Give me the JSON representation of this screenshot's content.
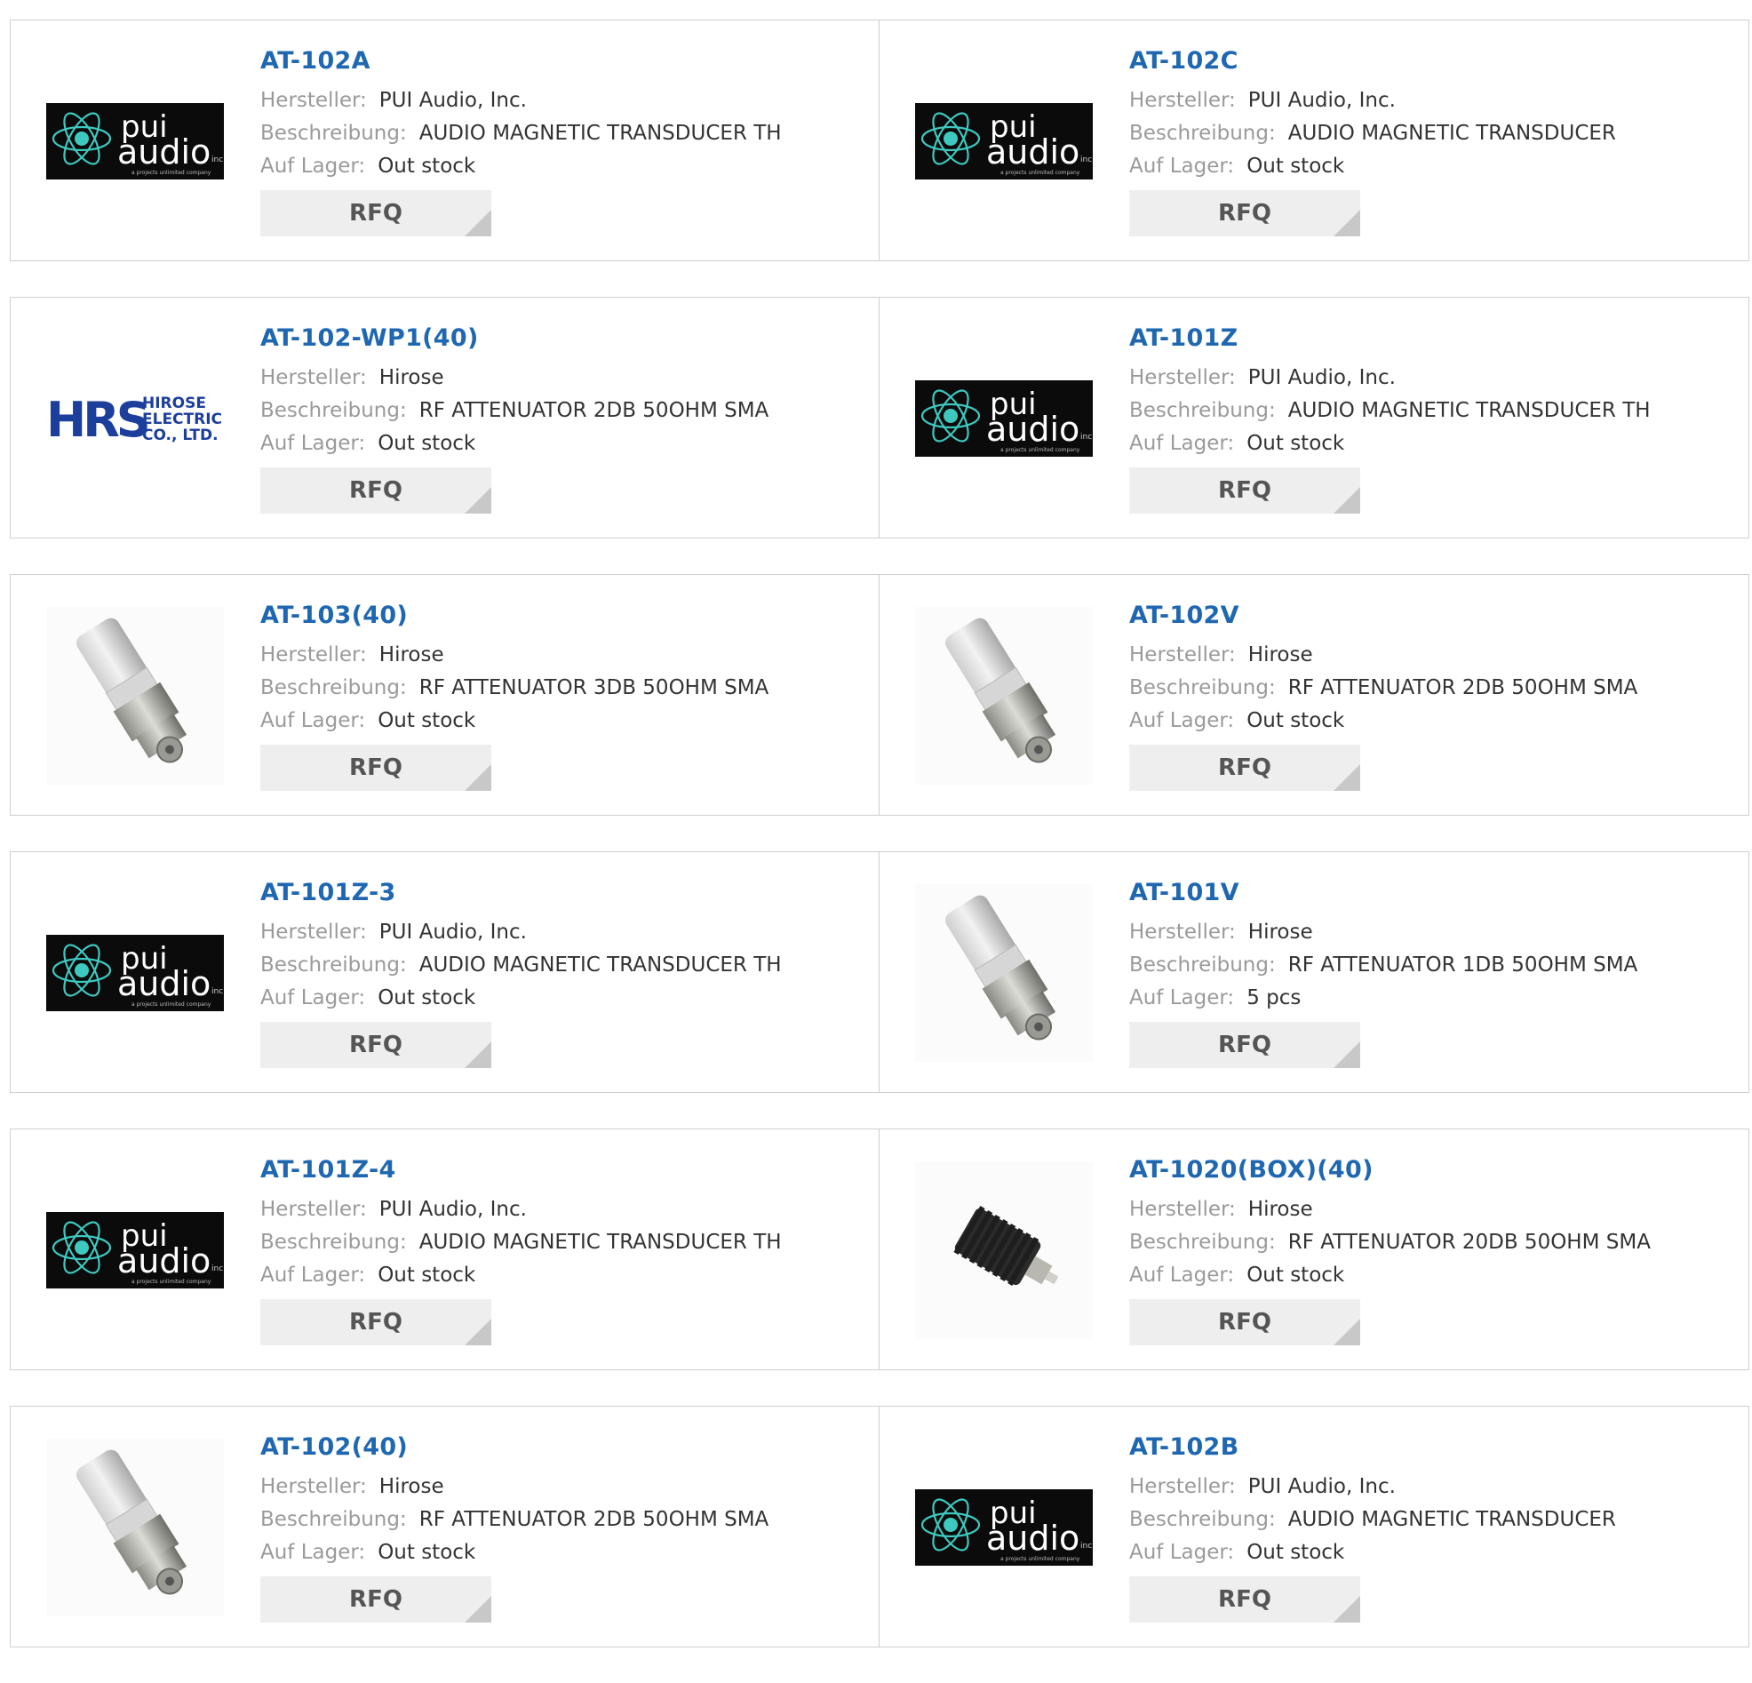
{
  "labels": {
    "manufacturer": "Hersteller:",
    "description": "Beschreibung:",
    "stock": "Auf Lager:",
    "rfq": "RFQ"
  },
  "products": [
    {
      "part": "AT-102A",
      "manufacturer": "PUI Audio, Inc.",
      "description": "AUDIO MAGNETIC TRANSDUCER TH",
      "stock": "Out stock",
      "image": "pui-audio-logo"
    },
    {
      "part": "AT-102C",
      "manufacturer": "PUI Audio, Inc.",
      "description": "AUDIO MAGNETIC TRANSDUCER",
      "stock": "Out stock",
      "image": "pui-audio-logo"
    },
    {
      "part": "AT-102-WP1(40)",
      "manufacturer": "Hirose",
      "description": "RF ATTENUATOR 2DB 50OHM SMA",
      "stock": "Out stock",
      "image": "hirose-logo"
    },
    {
      "part": "AT-101Z",
      "manufacturer": "PUI Audio, Inc.",
      "description": "AUDIO MAGNETIC TRANSDUCER TH",
      "stock": "Out stock",
      "image": "pui-audio-logo"
    },
    {
      "part": "AT-103(40)",
      "manufacturer": "Hirose",
      "description": "RF ATTENUATOR 3DB 50OHM SMA",
      "stock": "Out stock",
      "image": "sma-attenuator-photo"
    },
    {
      "part": "AT-102V",
      "manufacturer": "Hirose",
      "description": "RF ATTENUATOR 2DB 50OHM SMA",
      "stock": "Out stock",
      "image": "sma-attenuator-photo"
    },
    {
      "part": "AT-101Z-3",
      "manufacturer": "PUI Audio, Inc.",
      "description": "AUDIO MAGNETIC TRANSDUCER TH",
      "stock": "Out stock",
      "image": "pui-audio-logo"
    },
    {
      "part": "AT-101V",
      "manufacturer": "Hirose",
      "description": "RF ATTENUATOR 1DB 50OHM SMA",
      "stock": "5 pcs",
      "image": "sma-attenuator-photo"
    },
    {
      "part": "AT-101Z-4",
      "manufacturer": "PUI Audio, Inc.",
      "description": "AUDIO MAGNETIC TRANSDUCER TH",
      "stock": "Out stock",
      "image": "pui-audio-logo"
    },
    {
      "part": "AT-1020(BOX)(40)",
      "manufacturer": "Hirose",
      "description": "RF ATTENUATOR 20DB 50OHM SMA",
      "stock": "Out stock",
      "image": "heatsink-attenuator-photo"
    },
    {
      "part": "AT-102(40)",
      "manufacturer": "Hirose",
      "description": "RF ATTENUATOR 2DB 50OHM SMA",
      "stock": "Out stock",
      "image": "sma-attenuator-photo"
    },
    {
      "part": "AT-102B",
      "manufacturer": "PUI Audio, Inc.",
      "description": "AUDIO MAGNETIC TRANSDUCER",
      "stock": "Out stock",
      "image": "pui-audio-logo"
    }
  ],
  "logos": {
    "pui": {
      "line1": "pui",
      "line2": "audio",
      "suffix": "inc",
      "tagline": "a projects unlimited company"
    },
    "hirose": {
      "mark": "HRS",
      "line1": "HIROSE",
      "line2": "ELECTRIC",
      "line3": "CO., LTD."
    }
  },
  "colors": {
    "link": "#1f68b1",
    "label": "#9a9a9a",
    "value": "#333333",
    "button_bg": "#eeeeee",
    "button_corner": "#c8c8c8",
    "border": "#cfcfcf",
    "pui_bg": "#0b0b0b",
    "pui_accent": "#3ec9c0",
    "hirose_blue": "#1c3f9c"
  }
}
